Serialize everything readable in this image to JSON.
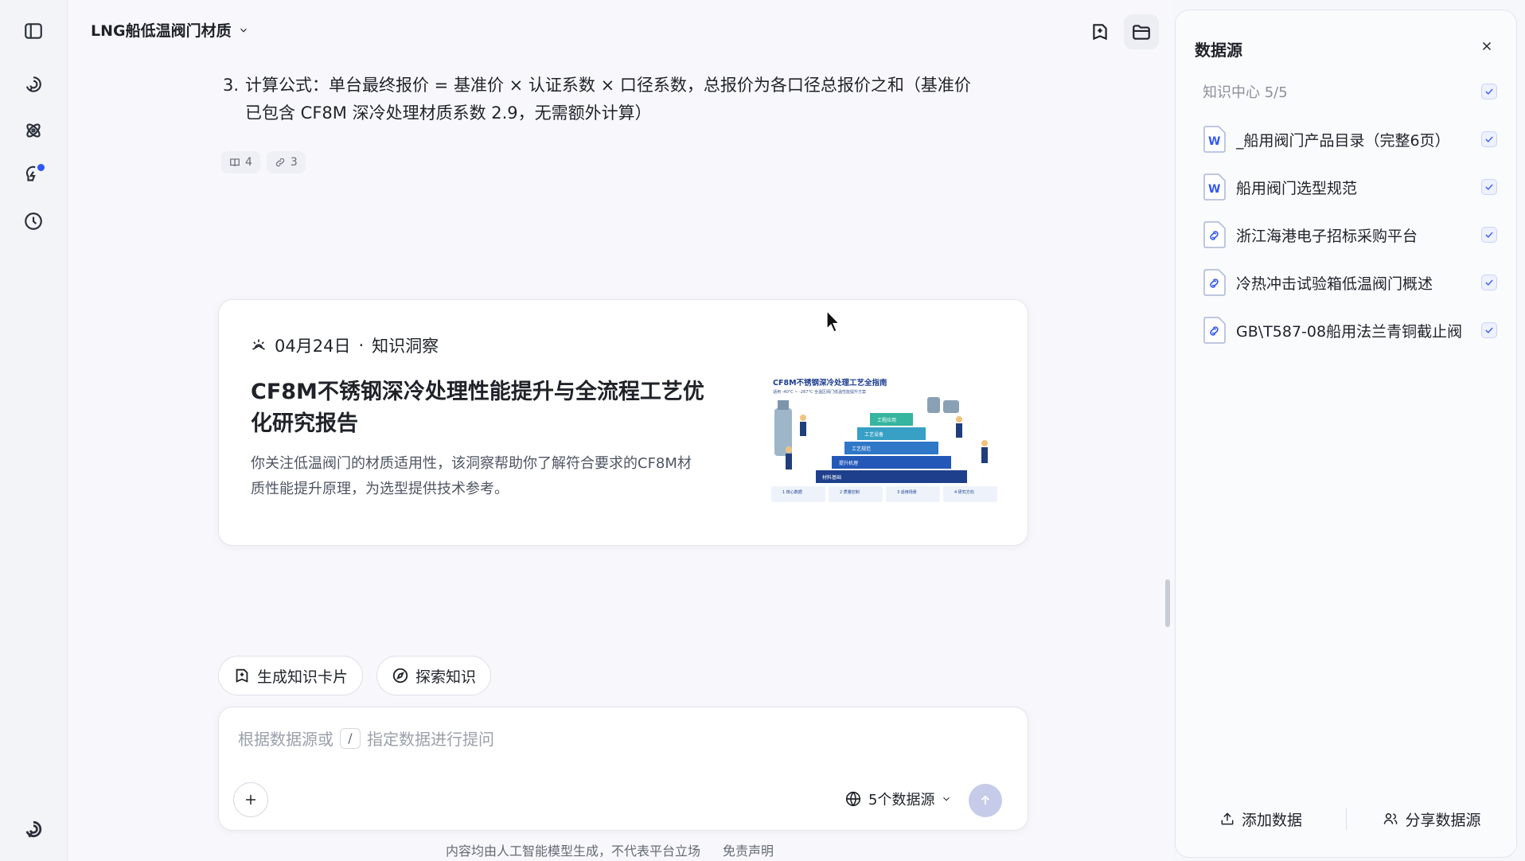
{
  "header": {
    "title": "LNG船低温阀门材质"
  },
  "conversation": {
    "formula_number": "3.",
    "formula_line1": "计算公式：单台最终报价 = 基准价 × 认证系数 × 口径系数，总报价为各口径总报价之和（基准价",
    "formula_line2": "已包含 CF8M 深冷处理材质系数 2.9，无需额外计算）",
    "citation_book_count": "4",
    "citation_link_count": "3"
  },
  "insight": {
    "date": "04月24日",
    "separator": "·",
    "category": "知识洞察",
    "title": "CF8M不锈钢深冷处理性能提升与全流程工艺优化研究报告",
    "description": "你关注低温阀门的材质适用性，该洞察帮助你了解符合要求的CF8M材质性能提升原理，为选型提供技术参考。",
    "thumbnail": {
      "title": "CF8M不锈钢深冷处理工艺全指南",
      "subtitle": "适用 -40°C ~ -267°C 全温区阀门低温性能提升方案",
      "tiers": [
        "工程应用",
        "工艺设备",
        "工艺规范",
        "提升机理",
        "材料基础"
      ],
      "cards": [
        "1 核心数据",
        "2 质量控制",
        "3 适用场景",
        "4 研究方向"
      ]
    }
  },
  "actions": {
    "generate_card": "生成知识卡片",
    "explore": "探索知识"
  },
  "composer": {
    "placeholder_prefix": "根据数据源或",
    "placeholder_key": "/",
    "placeholder_suffix": "指定数据进行提问",
    "source_count_label": "5个数据源"
  },
  "footer": {
    "notice": "内容均由人工智能模型生成，不代表平台立场",
    "disclaimer": "免责声明"
  },
  "panel": {
    "title": "数据源",
    "group_label": "知识中心 5/5",
    "sources": [
      {
        "type": "word",
        "name": "_船用阀门产品目录（完整6页）"
      },
      {
        "type": "word",
        "name": "船用阀门选型规范"
      },
      {
        "type": "link",
        "name": "浙江海港电子招标采购平台"
      },
      {
        "type": "link",
        "name": "冷热冲击试验箱低温阀门概述"
      },
      {
        "type": "link",
        "name": "GB\\T587-08船用法兰青铜截止阀"
      }
    ],
    "add_label": "添加数据",
    "share_label": "分享数据源"
  },
  "colors": {
    "accent": "#3358f4",
    "notification_dot": "#2f55f5",
    "send_disabled": "#c5cbe8"
  }
}
